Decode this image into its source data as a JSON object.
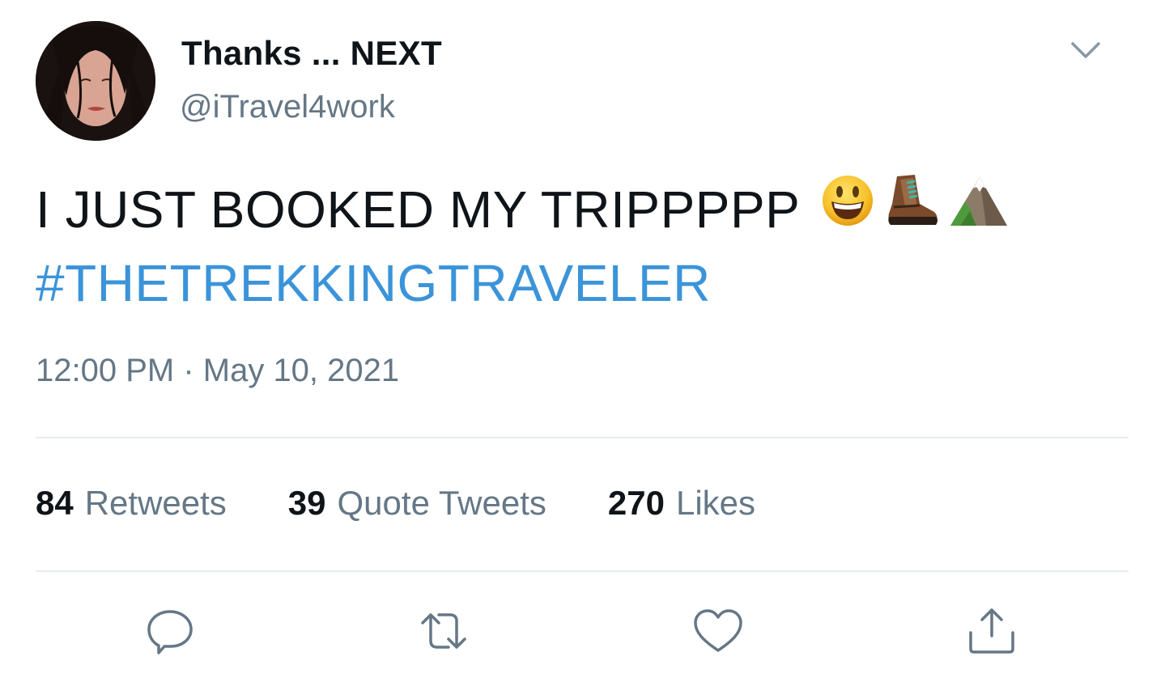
{
  "tweet": {
    "display_name": "Thanks ... NEXT",
    "handle": "@iTravel4work",
    "text": "I JUST BOOKED MY TRIPPPPP",
    "emojis": [
      "smiling-face-icon",
      "hiking-boot-icon",
      "mountain-icon"
    ],
    "hashtag": "#THETREKKINGTRAVELER",
    "timestamp": "12:00 PM · May 10, 2021"
  },
  "stats": [
    {
      "count": "84",
      "label": "Retweets"
    },
    {
      "count": "39",
      "label": "Quote Tweets"
    },
    {
      "count": "270",
      "label": "Likes"
    }
  ],
  "actions": [
    "reply-icon",
    "retweet-icon",
    "like-icon",
    "share-icon"
  ],
  "colors": {
    "hashtag": "#3b94d9",
    "secondary_text": "#657786",
    "divider": "#e6ecf0",
    "icon": "#657786"
  }
}
